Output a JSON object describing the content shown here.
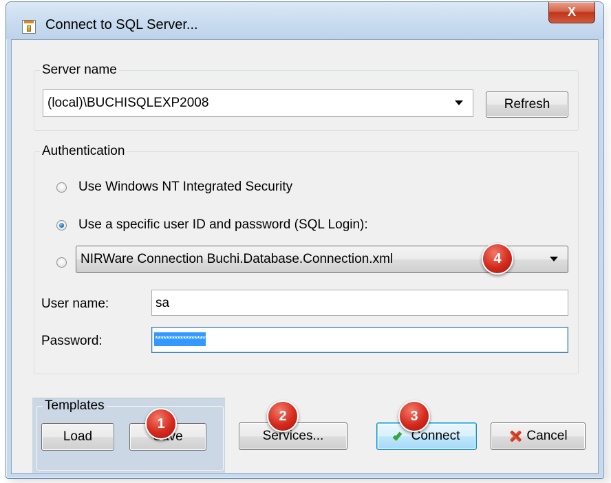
{
  "window": {
    "title": "Connect to SQL Server...",
    "close_glyph": "X",
    "icon": "database-icon"
  },
  "server": {
    "group_label": "Server name",
    "selected": "(local)\\BUCHISQLEXP2008",
    "refresh_label": "Refresh"
  },
  "auth": {
    "group_label": "Authentication",
    "option_windows": "Use Windows NT Integrated Security",
    "option_sql": "Use a specific user ID and password (SQL Login):",
    "selected_option": "sql",
    "connection_file": "NIRWare Connection Buchi.Database.Connection.xml",
    "username_label": "User name:",
    "username_value": "sa",
    "password_label": "Password:",
    "password_mask": "******************"
  },
  "templates": {
    "group_label": "Templates",
    "load_label": "Load",
    "save_label": "Save"
  },
  "buttons": {
    "services_label": "Services...",
    "connect_label": "Connect",
    "cancel_label": "Cancel"
  },
  "badges": [
    "1",
    "2",
    "3",
    "4"
  ],
  "colors": {
    "badge": "#d42a1d",
    "selection": "#3399ff",
    "window_frame": "#c5d9ef",
    "close_button": "#c0351a"
  }
}
